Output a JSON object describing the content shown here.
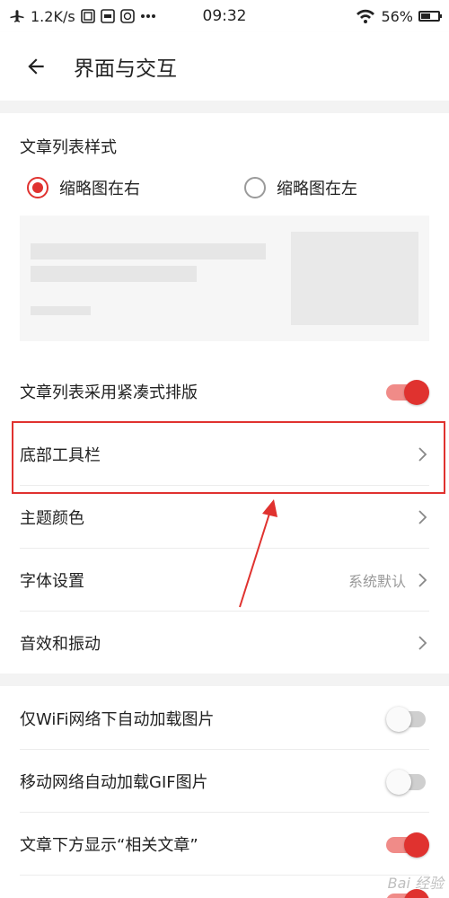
{
  "status_bar": {
    "network_speed": "1.2K/s",
    "time": "09:32",
    "battery_percent": "56%",
    "battery_level": 0.56,
    "icons": [
      "airplane-icon",
      "app-icon",
      "iqiyi-icon",
      "app-icon",
      "more-dots-icon",
      "wifi-icon",
      "battery-icon"
    ]
  },
  "header": {
    "title": "界面与交互",
    "back_icon": "arrow-left-icon"
  },
  "article_list_style": {
    "title": "文章列表样式",
    "options": [
      {
        "label": "缩略图在右",
        "selected": true
      },
      {
        "label": "缩略图在左",
        "selected": false
      }
    ]
  },
  "settings": [
    {
      "label": "文章列表采用紧凑式排版",
      "control": "toggle",
      "on": true
    },
    {
      "label": "底部工具栏",
      "control": "chevron"
    },
    {
      "label": "主题颜色",
      "control": "chevron"
    },
    {
      "label": "字体设置",
      "value": "系统默认",
      "control": "chevron"
    },
    {
      "label": "音效和振动",
      "control": "chevron"
    }
  ],
  "settings_2": [
    {
      "label": "仅WiFi网络下自动加载图片",
      "control": "toggle",
      "on": false
    },
    {
      "label": "移动网络自动加载GIF图片",
      "control": "toggle",
      "on": false
    },
    {
      "label": "文章下方显示“相关文章”",
      "control": "toggle",
      "on": true
    }
  ],
  "colors": {
    "accent": "#e0322f",
    "toggle_on_track": "#f08b88",
    "toggle_off_track": "#cfcfcf",
    "section_gap": "#f3f3f3"
  },
  "watermark": "Bai 经验"
}
